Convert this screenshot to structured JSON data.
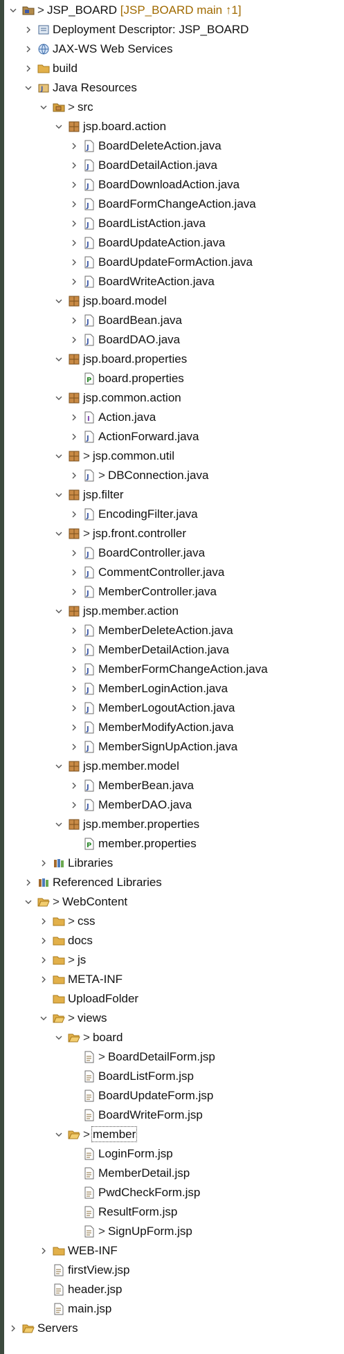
{
  "tree": {
    "nodes": [
      {
        "label": "JSP_BOARD",
        "deco": "[JSP_BOARD main ↑1]",
        "prefix": ">",
        "icon": "project-icon",
        "expanded": true,
        "level": 0
      },
      {
        "label": "Deployment Descriptor: JSP_BOARD",
        "icon": "deployment-descriptor-icon",
        "expanded": false,
        "level": 1
      },
      {
        "label": "JAX-WS Web Services",
        "icon": "web-services-icon",
        "expanded": false,
        "level": 1
      },
      {
        "label": "build",
        "icon": "folder-icon",
        "expanded": false,
        "level": 1
      },
      {
        "label": "Java Resources",
        "icon": "java-resources-icon",
        "expanded": true,
        "level": 1
      },
      {
        "label": "src",
        "prefix": ">",
        "icon": "source-folder-icon",
        "expanded": true,
        "level": 2
      },
      {
        "label": "jsp.board.action",
        "icon": "package-icon",
        "expanded": true,
        "level": 3
      },
      {
        "label": "BoardDeleteAction.java",
        "icon": "java-file-icon",
        "expanded": false,
        "level": 4
      },
      {
        "label": "BoardDetailAction.java",
        "icon": "java-file-icon",
        "expanded": false,
        "level": 4
      },
      {
        "label": "BoardDownloadAction.java",
        "icon": "java-file-icon",
        "expanded": false,
        "level": 4
      },
      {
        "label": "BoardFormChangeAction.java",
        "icon": "java-file-icon",
        "expanded": false,
        "level": 4
      },
      {
        "label": "BoardListAction.java",
        "icon": "java-file-icon",
        "expanded": false,
        "level": 4
      },
      {
        "label": "BoardUpdateAction.java",
        "icon": "java-file-icon",
        "expanded": false,
        "level": 4
      },
      {
        "label": "BoardUpdateFormAction.java",
        "icon": "java-file-icon",
        "expanded": false,
        "level": 4
      },
      {
        "label": "BoardWriteAction.java",
        "icon": "java-file-icon",
        "expanded": false,
        "level": 4
      },
      {
        "label": "jsp.board.model",
        "icon": "package-icon",
        "expanded": true,
        "level": 3
      },
      {
        "label": "BoardBean.java",
        "icon": "java-file-icon",
        "expanded": false,
        "level": 4
      },
      {
        "label": "BoardDAO.java",
        "icon": "java-file-icon",
        "expanded": false,
        "level": 4
      },
      {
        "label": "jsp.board.properties",
        "icon": "package-icon",
        "expanded": true,
        "level": 3
      },
      {
        "label": "board.properties",
        "icon": "properties-file-icon",
        "leaf": true,
        "level": 4
      },
      {
        "label": "jsp.common.action",
        "icon": "package-icon",
        "expanded": true,
        "level": 3
      },
      {
        "label": "Action.java",
        "icon": "java-interface-icon",
        "expanded": false,
        "level": 4
      },
      {
        "label": "ActionForward.java",
        "icon": "java-file-icon",
        "expanded": false,
        "level": 4
      },
      {
        "label": "jsp.common.util",
        "prefix": ">",
        "icon": "package-icon",
        "expanded": true,
        "level": 3
      },
      {
        "label": "DBConnection.java",
        "prefix": ">",
        "icon": "java-file-icon",
        "expanded": false,
        "level": 4
      },
      {
        "label": "jsp.filter",
        "icon": "package-icon",
        "expanded": true,
        "level": 3
      },
      {
        "label": "EncodingFilter.java",
        "icon": "java-file-icon",
        "expanded": false,
        "level": 4
      },
      {
        "label": "jsp.front.controller",
        "prefix": ">",
        "icon": "package-icon",
        "expanded": true,
        "level": 3
      },
      {
        "label": "BoardController.java",
        "icon": "java-file-icon",
        "expanded": false,
        "level": 4
      },
      {
        "label": "CommentController.java",
        "icon": "java-file-icon",
        "expanded": false,
        "level": 4
      },
      {
        "label": "MemberController.java",
        "icon": "java-file-icon",
        "expanded": false,
        "level": 4
      },
      {
        "label": "jsp.member.action",
        "icon": "package-icon",
        "expanded": true,
        "level": 3
      },
      {
        "label": "MemberDeleteAction.java",
        "icon": "java-file-icon",
        "expanded": false,
        "level": 4
      },
      {
        "label": "MemberDetailAction.java",
        "icon": "java-file-icon",
        "expanded": false,
        "level": 4
      },
      {
        "label": "MemberFormChangeAction.java",
        "icon": "java-file-icon",
        "expanded": false,
        "level": 4
      },
      {
        "label": "MemberLoginAction.java",
        "icon": "java-file-icon",
        "expanded": false,
        "level": 4
      },
      {
        "label": "MemberLogoutAction.java",
        "icon": "java-file-icon",
        "expanded": false,
        "level": 4
      },
      {
        "label": "MemberModifyAction.java",
        "icon": "java-file-icon",
        "expanded": false,
        "level": 4
      },
      {
        "label": "MemberSignUpAction.java",
        "icon": "java-file-icon",
        "expanded": false,
        "level": 4
      },
      {
        "label": "jsp.member.model",
        "icon": "package-icon",
        "expanded": true,
        "level": 3
      },
      {
        "label": "MemberBean.java",
        "icon": "java-file-icon",
        "expanded": false,
        "level": 4
      },
      {
        "label": "MemberDAO.java",
        "icon": "java-file-icon",
        "expanded": false,
        "level": 4
      },
      {
        "label": "jsp.member.properties",
        "icon": "package-icon",
        "expanded": true,
        "level": 3
      },
      {
        "label": "member.properties",
        "icon": "properties-file-icon",
        "leaf": true,
        "level": 4
      },
      {
        "label": "Libraries",
        "icon": "libraries-icon",
        "expanded": false,
        "level": 2
      },
      {
        "label": "Referenced Libraries",
        "icon": "libraries-icon",
        "expanded": false,
        "level": 1
      },
      {
        "label": "WebContent",
        "prefix": ">",
        "icon": "folder-open-icon",
        "expanded": true,
        "level": 1
      },
      {
        "label": "css",
        "prefix": ">",
        "icon": "folder-icon",
        "expanded": false,
        "level": 2
      },
      {
        "label": "docs",
        "icon": "folder-icon",
        "expanded": false,
        "level": 2
      },
      {
        "label": "js",
        "prefix": ">",
        "icon": "folder-icon",
        "expanded": false,
        "level": 2
      },
      {
        "label": "META-INF",
        "icon": "folder-icon",
        "expanded": false,
        "level": 2
      },
      {
        "label": "UploadFolder",
        "icon": "folder-icon",
        "leaf": true,
        "level": 2
      },
      {
        "label": "views",
        "prefix": ">",
        "icon": "folder-open-icon",
        "expanded": true,
        "level": 2
      },
      {
        "label": "board",
        "prefix": ">",
        "icon": "folder-open-icon",
        "expanded": true,
        "level": 3
      },
      {
        "label": "BoardDetailForm.jsp",
        "prefix": ">",
        "icon": "jsp-file-icon",
        "leaf": true,
        "level": 4
      },
      {
        "label": "BoardListForm.jsp",
        "icon": "jsp-file-icon",
        "leaf": true,
        "level": 4
      },
      {
        "label": "BoardUpdateForm.jsp",
        "icon": "jsp-file-icon",
        "leaf": true,
        "level": 4
      },
      {
        "label": "BoardWriteForm.jsp",
        "icon": "jsp-file-icon",
        "leaf": true,
        "level": 4
      },
      {
        "label": "member",
        "prefix": ">",
        "icon": "folder-open-icon",
        "expanded": true,
        "level": 3,
        "selected": true
      },
      {
        "label": "LoginForm.jsp",
        "icon": "jsp-file-icon",
        "leaf": true,
        "level": 4
      },
      {
        "label": "MemberDetail.jsp",
        "icon": "jsp-file-icon",
        "leaf": true,
        "level": 4
      },
      {
        "label": "PwdCheckForm.jsp",
        "icon": "jsp-file-icon",
        "leaf": true,
        "level": 4
      },
      {
        "label": "ResultForm.jsp",
        "icon": "jsp-file-icon",
        "leaf": true,
        "level": 4
      },
      {
        "label": "SignUpForm.jsp",
        "prefix": ">",
        "icon": "jsp-file-icon",
        "leaf": true,
        "level": 4
      },
      {
        "label": "WEB-INF",
        "icon": "folder-icon",
        "expanded": false,
        "level": 2
      },
      {
        "label": "firstView.jsp",
        "icon": "jsp-file-icon",
        "leaf": true,
        "level": 2
      },
      {
        "label": "header.jsp",
        "icon": "jsp-file-icon",
        "leaf": true,
        "level": 2
      },
      {
        "label": "main.jsp",
        "icon": "jsp-file-icon",
        "leaf": true,
        "level": 2
      },
      {
        "label": "Servers",
        "icon": "folder-open-icon",
        "expanded": false,
        "level": 0
      }
    ]
  },
  "colors": {
    "left_bar": "#3c4a3e",
    "folder": "#e2b04a",
    "package": "#b5793a",
    "java_file": "#6d7fb3",
    "decoration": "#a06a00"
  }
}
